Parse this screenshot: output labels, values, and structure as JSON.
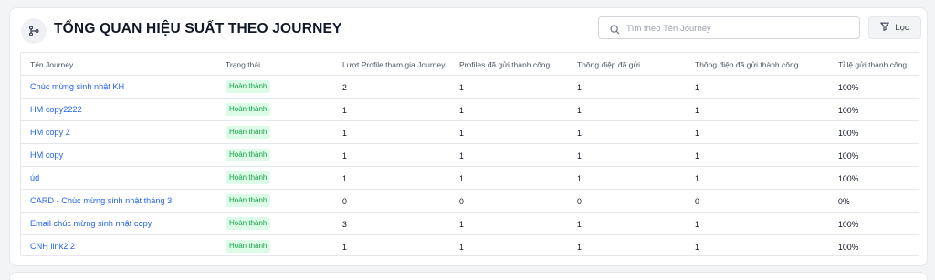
{
  "header": {
    "title": "TỔNG QUAN HIỆU SUẤT THEO JOURNEY",
    "icon": "journey-branch-icon"
  },
  "search": {
    "placeholder": "Tìm theo Tên Journey",
    "value": ""
  },
  "filter": {
    "label": "Lọc",
    "icon": "filter-icon"
  },
  "colors": {
    "link": "#2563eb",
    "badge_bg": "#dcfce7",
    "badge_text": "#16a34a"
  },
  "table": {
    "columns": [
      "Tên Journey",
      "Trạng thái",
      "Lượt Profile tham gia Journey",
      "Profiles đã gửi thành công",
      "Thông điệp đã gửi",
      "Thông điệp đã gửi thành công",
      "Tỉ lệ gửi thành công"
    ],
    "rows": [
      {
        "name": "Chúc mừng sinh nhật KH",
        "status": "Hoàn thành",
        "participants": "2",
        "profiles_sent": "1",
        "messages_sent": "1",
        "messages_success": "1",
        "rate": "100%"
      },
      {
        "name": "HM copy2222",
        "status": "Hoàn thành",
        "participants": "1",
        "profiles_sent": "1",
        "messages_sent": "1",
        "messages_success": "1",
        "rate": "100%"
      },
      {
        "name": "HM copy 2",
        "status": "Hoàn thành",
        "participants": "1",
        "profiles_sent": "1",
        "messages_sent": "1",
        "messages_success": "1",
        "rate": "100%"
      },
      {
        "name": "HM copy",
        "status": "Hoàn thành",
        "participants": "1",
        "profiles_sent": "1",
        "messages_sent": "1",
        "messages_success": "1",
        "rate": "100%"
      },
      {
        "name": "úd",
        "status": "Hoàn thành",
        "participants": "1",
        "profiles_sent": "1",
        "messages_sent": "1",
        "messages_success": "1",
        "rate": "100%"
      },
      {
        "name": "CARD - Chúc mừng sinh nhật tháng 3",
        "status": "Hoàn thành",
        "participants": "0",
        "profiles_sent": "0",
        "messages_sent": "0",
        "messages_success": "0",
        "rate": "0%"
      },
      {
        "name": "Email chúc mừng sinh nhật copy",
        "status": "Hoàn thành",
        "participants": "3",
        "profiles_sent": "1",
        "messages_sent": "1",
        "messages_success": "1",
        "rate": "100%"
      },
      {
        "name": "CNH link2 2",
        "status": "Hoàn thành",
        "participants": "1",
        "profiles_sent": "1",
        "messages_sent": "1",
        "messages_success": "1",
        "rate": "100%"
      }
    ]
  }
}
